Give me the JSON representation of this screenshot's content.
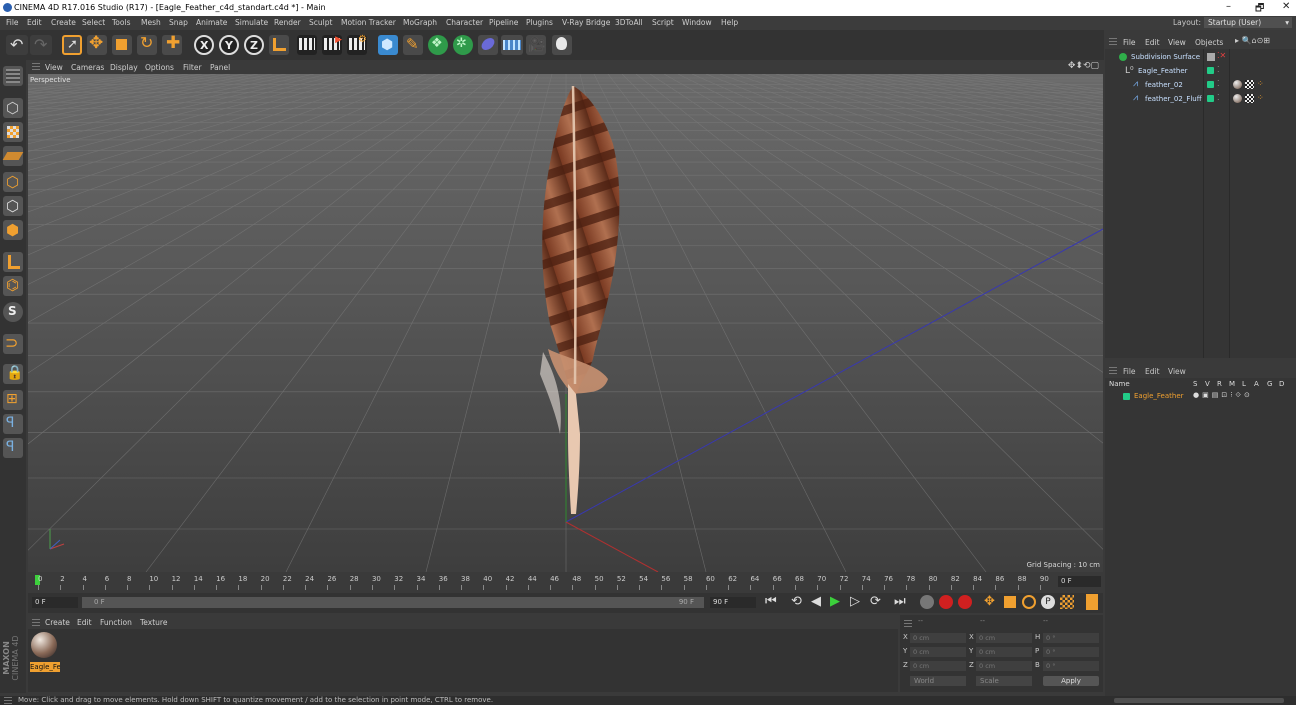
{
  "window": {
    "title": "CINEMA 4D R17.016 Studio (R17) - [Eagle_Feather_c4d_standart.c4d *] - Main",
    "controls": [
      "–",
      "🗗",
      "✕"
    ]
  },
  "menubar": {
    "items": [
      "File",
      "Edit",
      "Create",
      "Select",
      "Tools",
      "Mesh",
      "Snap",
      "Animate",
      "Simulate",
      "Render",
      "Sculpt",
      "Motion Tracker",
      "MoGraph",
      "Character",
      "Pipeline",
      "Plugins",
      "V-Ray Bridge",
      "3DToAll",
      "Script",
      "Window",
      "Help"
    ],
    "layout_label": "Layout:",
    "layout_value": "Startup (User)"
  },
  "toolbar": {
    "axis_x": "X",
    "axis_y": "Y",
    "axis_z": "Z"
  },
  "viewport": {
    "menu": [
      "View",
      "Cameras",
      "Display",
      "Options",
      "Filter",
      "Panel"
    ],
    "camera_label": "Perspective",
    "grid_spacing": "Grid Spacing : 10 cm"
  },
  "timeline": {
    "ticks": [
      "0",
      "2",
      "4",
      "6",
      "8",
      "10",
      "12",
      "14",
      "16",
      "18",
      "20",
      "22",
      "24",
      "26",
      "28",
      "30",
      "32",
      "34",
      "36",
      "38",
      "40",
      "42",
      "44",
      "46",
      "48",
      "50",
      "52",
      "54",
      "56",
      "58",
      "60",
      "62",
      "64",
      "66",
      "68",
      "70",
      "72",
      "74",
      "76",
      "78",
      "80",
      "82",
      "84",
      "86",
      "88",
      "90"
    ],
    "current_frame": "0 F",
    "start_field": "0 F",
    "slider_start": "0 F",
    "slider_end": "90 F",
    "end_field": "90 F"
  },
  "material_manager": {
    "menu": [
      "Create",
      "Edit",
      "Function",
      "Texture"
    ],
    "materials": [
      {
        "name": "Eagle_Fe"
      }
    ]
  },
  "branding": {
    "maxon": "MAXON",
    "c4d": "CINEMA 4D"
  },
  "coordinates": {
    "header": [
      "--",
      "--",
      "--"
    ],
    "rows": [
      {
        "a": "X",
        "av": "0 cm",
        "b": "X",
        "bv": "0 cm",
        "c": "H",
        "cv": "0 °"
      },
      {
        "a": "Y",
        "av": "0 cm",
        "b": "Y",
        "bv": "0 cm",
        "c": "P",
        "cv": "0 °"
      },
      {
        "a": "Z",
        "av": "0 cm",
        "b": "Z",
        "bv": "0 cm",
        "c": "B",
        "cv": "0 °"
      }
    ],
    "mode_world": "World",
    "mode_scale": "Scale",
    "apply": "Apply"
  },
  "object_manager": {
    "menu": [
      "File",
      "Edit",
      "View",
      "Objects"
    ],
    "objects": [
      {
        "name": "Subdivision Surface",
        "level": 0
      },
      {
        "name": "Eagle_Feather",
        "level": 1
      },
      {
        "name": "feather_02",
        "level": 2
      },
      {
        "name": "feather_02_Fluff",
        "level": 2
      }
    ]
  },
  "layer_manager": {
    "menu": [
      "File",
      "Edit",
      "View"
    ],
    "columns_label": "Name",
    "columns": [
      "S",
      "V",
      "R",
      "M",
      "L",
      "A",
      "G",
      "D"
    ],
    "layers": [
      {
        "name": "Eagle_Feather",
        "color": "#22cc88"
      }
    ]
  },
  "status": {
    "text": "Move: Click and drag to move elements. Hold down SHIFT to quantize movement / add to the selection in point mode, CTRL to remove."
  },
  "colors": {
    "accent_orange": "#f0a030",
    "layer_green": "#22cc88",
    "viewport_bg": "#4c4c4c"
  }
}
